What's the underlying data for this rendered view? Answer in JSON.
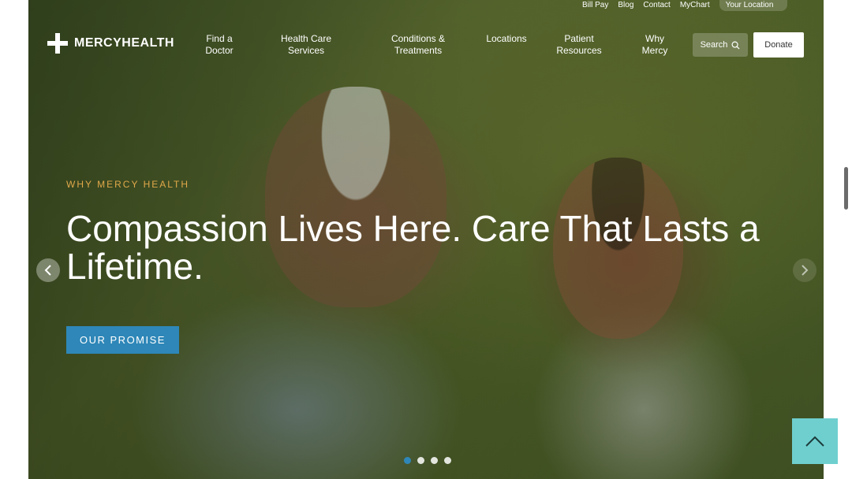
{
  "utility_nav": {
    "items": [
      "Bill Pay",
      "Blog",
      "Contact",
      "MyChart"
    ],
    "location_label": "Your Location"
  },
  "header": {
    "brand": "MERCYHEALTH",
    "nav": [
      {
        "line1": "Find a",
        "line2": "Doctor"
      },
      {
        "line1": "Health Care",
        "line2": "Services"
      },
      {
        "line1": "Conditions &",
        "line2": "Treatments"
      },
      {
        "line1": "Locations",
        "line2": ""
      },
      {
        "line1": "Patient",
        "line2": "Resources"
      },
      {
        "line1": "Why",
        "line2": "Mercy"
      }
    ],
    "search_label": "Search",
    "donate_label": "Donate"
  },
  "hero": {
    "eyebrow": "WHY MERCY HEALTH",
    "headline": "Compassion Lives Here. Care That Lasts a Lifetime.",
    "cta_label": "OUR PROMISE",
    "slide_count": 4,
    "active_slide": 1
  },
  "icons": {
    "logo": "cross-logo-icon",
    "search": "search-icon",
    "prev": "chevron-left-icon",
    "next": "chevron-right-icon",
    "back_to_top": "chevron-up-icon"
  },
  "colors": {
    "accent": "#2e87b8",
    "eyebrow": "#e0a84a",
    "back_to_top": "#6fcfcf"
  }
}
